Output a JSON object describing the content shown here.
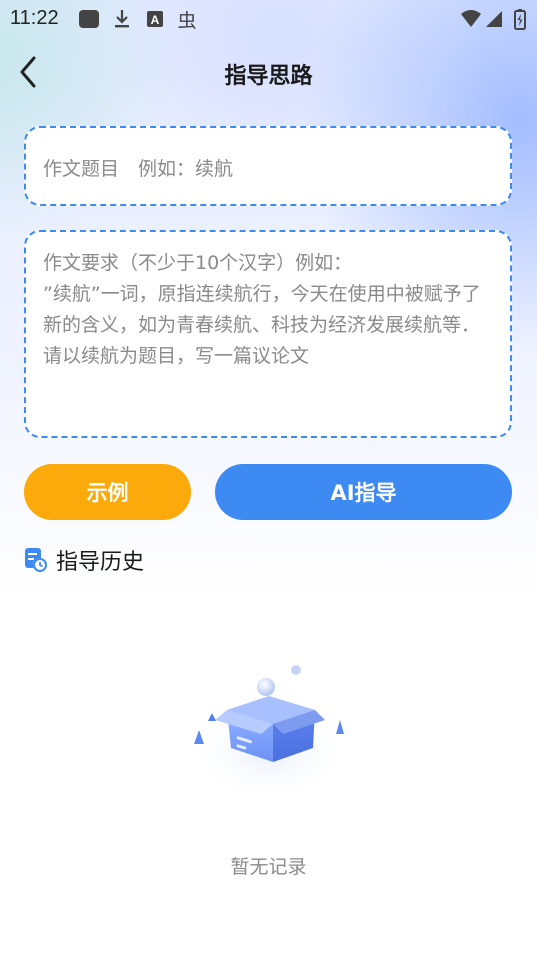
{
  "status_bar": {
    "time": "11:22",
    "icons": [
      "app-square-icon",
      "download-icon",
      "font-a-icon",
      "bug-icon",
      "wifi-icon",
      "signal-icon",
      "battery-icon"
    ]
  },
  "header": {
    "title": "指导思路"
  },
  "topic_input": {
    "placeholder": "作文题目　例如：续航"
  },
  "requirement_input": {
    "placeholder": "作文要求（不少于10个汉字）例如：\n”续航”一词，原指连续航行，今天在使用中被赋予了新的含义，如为青春续航、科技为经济发展续航等．请以续航为题目，写一篇议论文"
  },
  "buttons": {
    "example": "示例",
    "ai_guide": "AI指导"
  },
  "history": {
    "title": "指导历史",
    "empty_text": "暂无记录"
  },
  "colors": {
    "accent_blue": "#3d8bf2",
    "accent_orange": "#fca90c"
  }
}
